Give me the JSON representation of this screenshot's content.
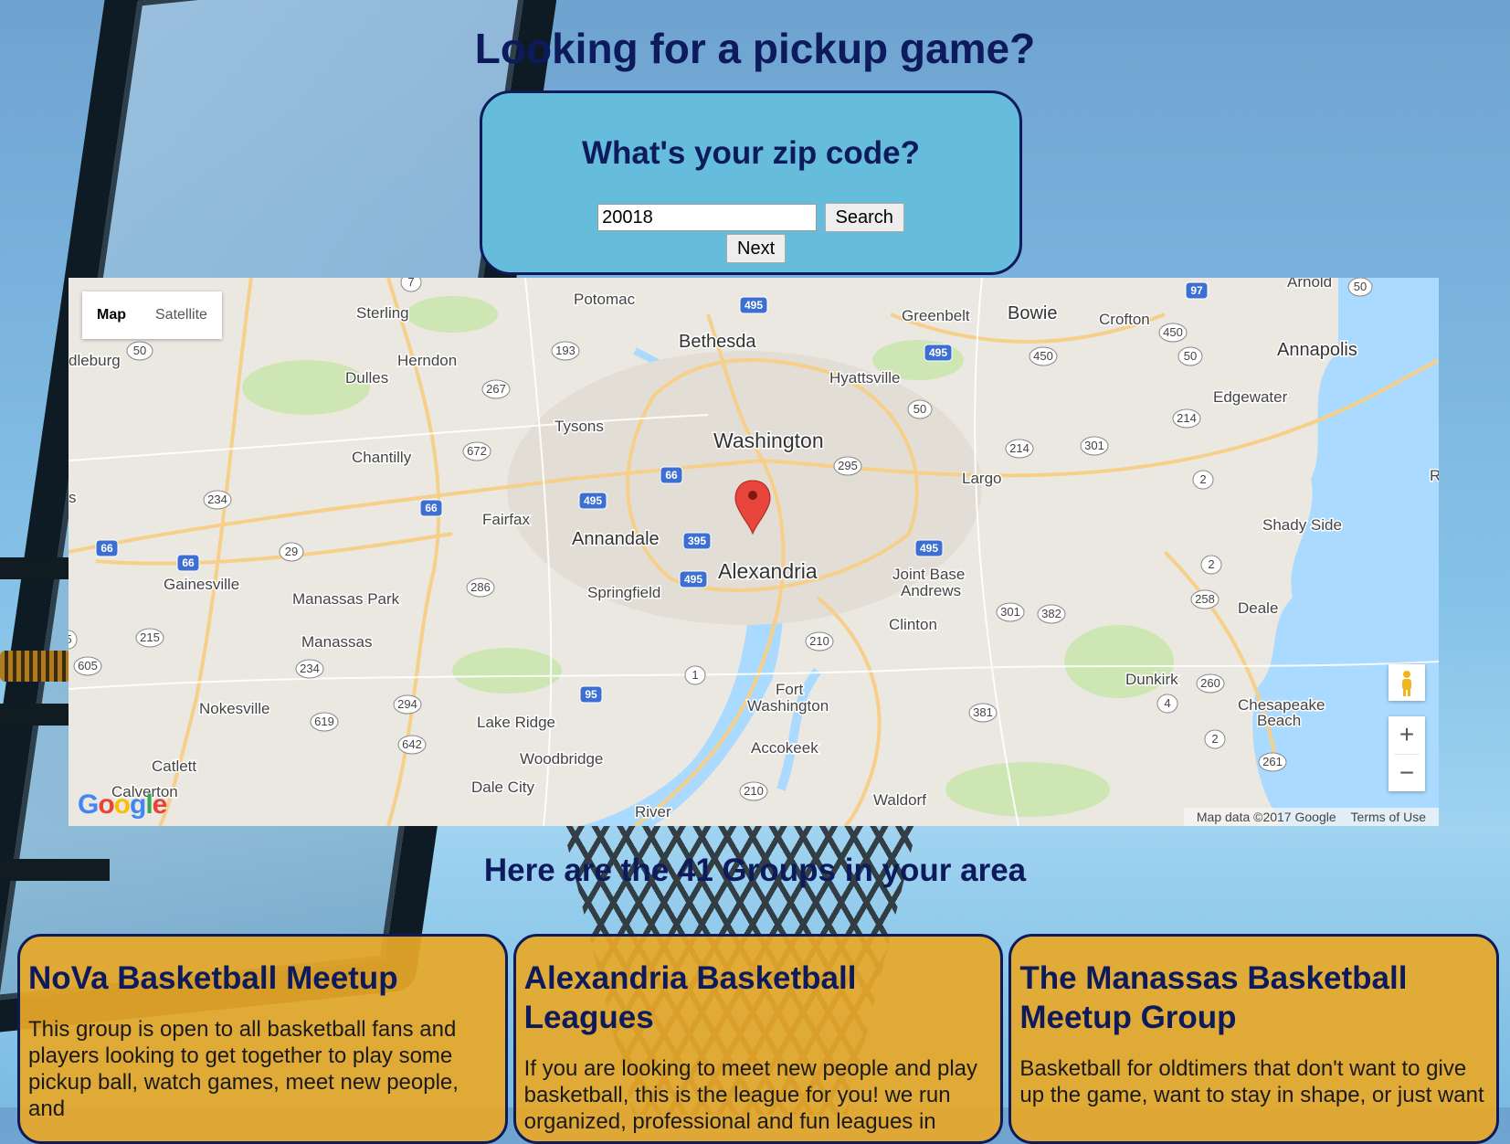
{
  "header": {
    "title": "Looking for a pickup game?"
  },
  "zip_form": {
    "heading": "What's your zip code?",
    "zip_value": "20018",
    "search_label": "Search",
    "next_label": "Next"
  },
  "map": {
    "type_controls": {
      "map": "Map",
      "satellite": "Satellite"
    },
    "zoom_in": "+",
    "zoom_out": "−",
    "attribution": "Map data ©2017 Google",
    "terms": "Terms of Use",
    "logo": "Google",
    "marker": "red-pin-icon",
    "labels": {
      "potomac": "Potomac",
      "sterling": "Sterling",
      "greenbelt": "Greenbelt",
      "bowie": "Bowie",
      "crofton": "Crofton",
      "arnold": "Arnold",
      "annapolis": "Annapolis",
      "bethesda": "Bethesda",
      "herndon": "Herndon",
      "dulles": "Dulles",
      "hyattsville": "Hyattsville",
      "edgewater": "Edgewater",
      "tysons": "Tysons",
      "washington": "Washington",
      "chantilly": "Chantilly",
      "largo": "Largo",
      "fairfax": "Fairfax",
      "annandale": "Annandale",
      "shady_side": "Shady Side",
      "gainesville": "Gainesville",
      "alexandria": "Alexandria",
      "springfield": "Springfield",
      "joint_base": "Joint Base",
      "andrews": "Andrews",
      "manassas_park": "Manassas Park",
      "deale": "Deale",
      "clinton": "Clinton",
      "manassas": "Manassas",
      "dunkirk": "Dunkirk",
      "fort": "Fort",
      "fort_washington": "Washington",
      "chesapeake": "Chesapeake",
      "beach": "Beach",
      "nokesville": "Nokesville",
      "lake_ridge": "Lake Ridge",
      "accokeek": "Accokeek",
      "woodbridge": "Woodbridge",
      "catlett": "Catlett",
      "calverton": "Calverton",
      "dale_city": "Dale City",
      "waldorf": "Waldorf",
      "river": "River",
      "middleburg": "dleburg",
      "s_edge": "s",
      "r_edge": "R"
    }
  },
  "groups": {
    "heading": "Here are the 41 Groups in your area",
    "items": [
      {
        "title": "NoVa Basketball Meetup",
        "description": "This group is open to all basketball fans and players looking to get together to play some pickup ball, watch games, meet new people, and"
      },
      {
        "title": "Alexandria Basketball Leagues",
        "description": "If you are looking to meet new people and play basketball, this is the league for you! we run organized, professional and fun leagues in"
      },
      {
        "title": "The Manassas Basketball Meetup Group",
        "description": "Basketball for oldtimers that don't want to give up the game, want to stay in shape, or just want"
      }
    ]
  },
  "colors": {
    "heading_navy": "#0d1a5c",
    "zip_card_bg": "#66bcdb",
    "group_card_bg": "#e8a828"
  }
}
